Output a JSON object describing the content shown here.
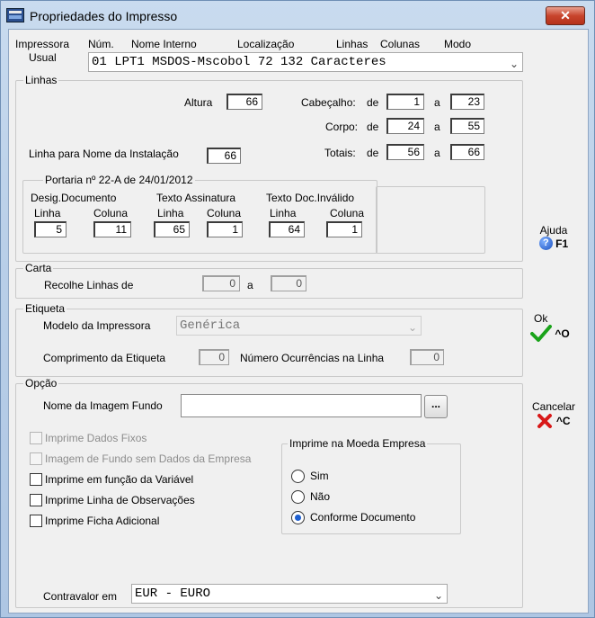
{
  "window": {
    "title": "Propriedades do Impresso",
    "close_glyph": "✕"
  },
  "header": {
    "impressora": "Impressora",
    "usual": "Usual",
    "num": "Núm.",
    "nome_interno": "Nome Interno",
    "localizacao": "Localização",
    "linhas": "Linhas",
    "colunas": "Colunas",
    "modo": "Modo",
    "printer_value": "01 LPT1      MSDOS-Mscobol   72 132 Caracteres"
  },
  "linhas": {
    "legend": "Linhas",
    "altura_label": "Altura",
    "altura": "66",
    "cabecalho_label": "Cabeçalho:",
    "cab_de": "1",
    "cab_a": "23",
    "corpo_label": "Corpo:",
    "corpo_de": "24",
    "corpo_a": "55",
    "totais_label": "Totais:",
    "tot_de": "56",
    "tot_a": "66",
    "de": "de",
    "a": "a",
    "nome_instalacao_label": "Linha para Nome da Instalação",
    "nome_instalacao": "66",
    "portaria": {
      "legend": "Portaria nº 22-A de 24/01/2012",
      "desig_label": "Desig.Documento",
      "texto_assinatura_label": "Texto Assinatura",
      "texto_invalido_label": "Texto Doc.Inválido",
      "linha": "Linha",
      "coluna": "Coluna",
      "desig_linha": "5",
      "desig_coluna": "11",
      "assin_linha": "65",
      "assin_coluna": "1",
      "inval_linha": "64",
      "inval_coluna": "1"
    }
  },
  "carta": {
    "legend": "Carta",
    "recolhe_label": "Recolhe Linhas de",
    "de": "0",
    "a_label": "a",
    "a": "0"
  },
  "etiqueta": {
    "legend": "Etiqueta",
    "modelo_label": "Modelo da Impressora",
    "modelo_value": "Genérica",
    "comprimento_label": "Comprimento da Etiqueta",
    "comprimento": "0",
    "ocorrencias_label": "Número Ocurrências na Linha",
    "ocorrencias": "0"
  },
  "opcao": {
    "legend": "Opção",
    "imagem_label": "Nome da Imagem Fundo",
    "imagem_value": "",
    "dots": "...",
    "checks": [
      {
        "label": "Imprime Dados Fixos",
        "checked": false,
        "disabled": true
      },
      {
        "label": "Imagem de Fundo sem Dados da Empresa",
        "checked": false,
        "disabled": true
      },
      {
        "label": "Imprime em função da Variável",
        "checked": false,
        "disabled": false
      },
      {
        "label": "Imprime Linha de Observações",
        "checked": false,
        "disabled": false
      },
      {
        "label": "Imprime Ficha Adicional",
        "checked": false,
        "disabled": false
      }
    ],
    "moeda": {
      "legend": "Imprime na Moeda Empresa",
      "options": [
        "Sim",
        "Não",
        "Conforme Documento"
      ],
      "selected": "Conforme Documento"
    },
    "contravalor_label": "Contravalor em",
    "contravalor_value": "EUR  - EURO"
  },
  "side": {
    "ajuda_label": "Ajuda",
    "ajuda_key": "F1",
    "ok_label": "Ok",
    "ok_key": "^O",
    "cancelar_label": "Cancelar",
    "cancelar_key": "^C"
  },
  "colors": {
    "accent": "#1e5fd0",
    "ok_green": "#1aa31a",
    "cancel_red": "#d81818",
    "title_bar": "#b9cfe8"
  }
}
